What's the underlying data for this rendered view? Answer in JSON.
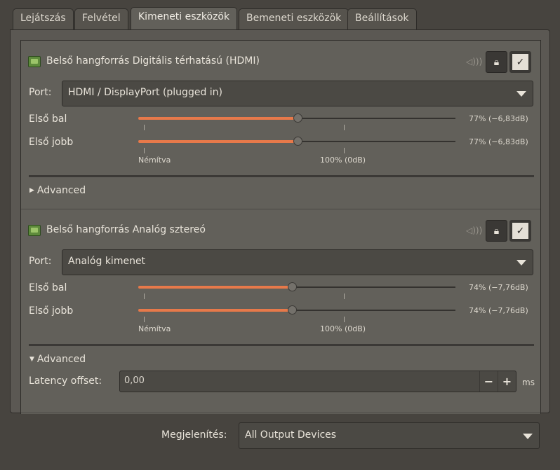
{
  "tabs": [
    {
      "label": "Lejátszás"
    },
    {
      "label": "Felvétel"
    },
    {
      "label": "Kimeneti eszközök"
    },
    {
      "label": "Bemeneti eszközök"
    },
    {
      "label": "Beállítások"
    }
  ],
  "active_tab": "Kimeneti eszközök",
  "devices": [
    {
      "title": "Belső hangforrás Digitális térhatású (HDMI)",
      "port_label": "Port:",
      "port_value": "HDMI / DisplayPort (plugged in)",
      "channels": [
        {
          "label": "Első bal",
          "percent": 77,
          "value_text": "77% (−6,83dB)"
        },
        {
          "label": "Első jobb",
          "percent": 77,
          "value_text": "77% (−6,83dB)"
        }
      ],
      "mark_muted": "Némítva",
      "mark_100": "100% (0dB)",
      "advanced_label": "Advanced",
      "advanced_expanded": false
    },
    {
      "title": "Belső hangforrás Analóg sztereó",
      "port_label": "Port:",
      "port_value": "Analóg kimenet",
      "channels": [
        {
          "label": "Első bal",
          "percent": 74,
          "value_text": "74% (−7,76dB)"
        },
        {
          "label": "Első jobb",
          "percent": 74,
          "value_text": "74% (−7,76dB)"
        }
      ],
      "mark_muted": "Némítva",
      "mark_100": "100% (0dB)",
      "advanced_label": "Advanced",
      "advanced_expanded": true,
      "latency_label": "Latency offset:",
      "latency_value": "0,00",
      "latency_unit": "ms"
    }
  ],
  "footer": {
    "label": "Megjelenítés:",
    "value": "All Output Devices"
  },
  "icons": {
    "device": "sound-card-icon",
    "speaker": "speaker-icon",
    "lock": "lock-icon",
    "check": "check-icon"
  },
  "colors": {
    "slider_fill": "#e7794a",
    "background": "#47443f",
    "panel": "#62605a"
  }
}
